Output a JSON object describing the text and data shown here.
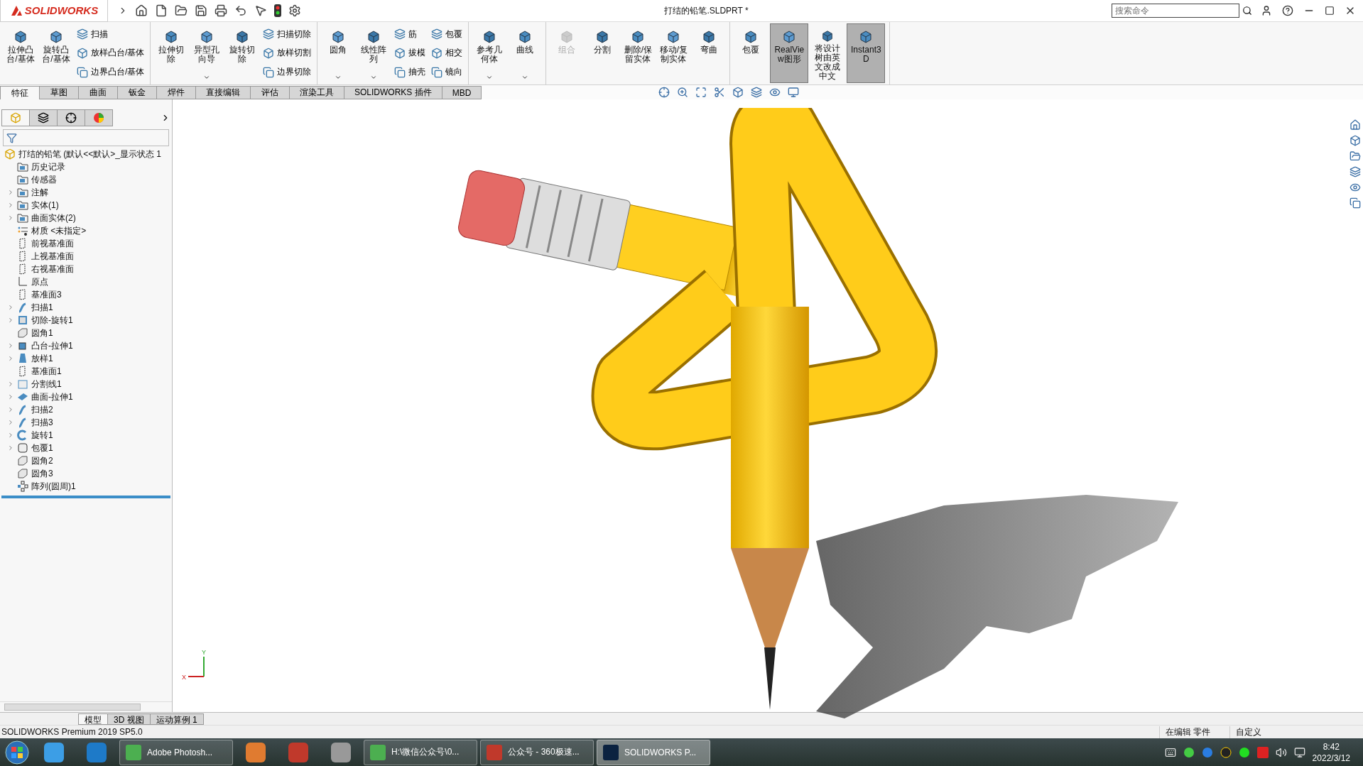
{
  "title_bar": {
    "logo": "SOLIDWORKS",
    "document_title": "打结的铅笔.SLDPRT *",
    "search_placeholder": "搜索命令"
  },
  "command_groups": [
    [
      {
        "kind": "large",
        "label": "拉伸凸台/基体",
        "dropdown": false,
        "selected": false,
        "disabled": false
      },
      {
        "kind": "large",
        "label": "旋转凸台/基体",
        "dropdown": false,
        "selected": false,
        "disabled": false
      },
      {
        "kind": "stack",
        "items": [
          {
            "label": "扫描"
          },
          {
            "label": "放样凸台/基体"
          },
          {
            "label": "边界凸台/基体"
          }
        ]
      }
    ],
    [
      {
        "kind": "large",
        "label": "拉伸切除",
        "dropdown": false,
        "selected": false,
        "disabled": false
      },
      {
        "kind": "large",
        "label": "异型孔向导",
        "dropdown": true,
        "selected": false,
        "disabled": false
      },
      {
        "kind": "large",
        "label": "旋转切除",
        "dropdown": false,
        "selected": false,
        "disabled": false
      },
      {
        "kind": "stack",
        "items": [
          {
            "label": "扫描切除"
          },
          {
            "label": "放样切割"
          },
          {
            "label": "边界切除"
          }
        ]
      }
    ],
    [
      {
        "kind": "large",
        "label": "圆角",
        "dropdown": true,
        "selected": false,
        "disabled": false
      },
      {
        "kind": "large",
        "label": "线性阵列",
        "dropdown": true,
        "selected": false,
        "disabled": false
      },
      {
        "kind": "stack",
        "items": [
          {
            "label": "筋"
          },
          {
            "label": "拔模"
          },
          {
            "label": "抽壳"
          }
        ]
      },
      {
        "kind": "stack",
        "items": [
          {
            "label": "包覆"
          },
          {
            "label": "相交"
          },
          {
            "label": "镜向"
          }
        ]
      }
    ],
    [
      {
        "kind": "large",
        "label": "参考几何体",
        "dropdown": true,
        "selected": false,
        "disabled": false
      },
      {
        "kind": "large",
        "label": "曲线",
        "dropdown": true,
        "selected": false,
        "disabled": false
      }
    ],
    [
      {
        "kind": "large",
        "label": "组合",
        "dropdown": false,
        "selected": false,
        "disabled": true
      },
      {
        "kind": "large",
        "label": "分割",
        "dropdown": false,
        "selected": false,
        "disabled": false
      },
      {
        "kind": "large",
        "label": "删除/保留实体",
        "dropdown": false,
        "selected": false,
        "disabled": false
      },
      {
        "kind": "large",
        "label": "移动/复制实体",
        "dropdown": false,
        "selected": false,
        "disabled": false
      },
      {
        "kind": "large",
        "label": "弯曲",
        "dropdown": false,
        "selected": false,
        "disabled": false
      }
    ],
    [
      {
        "kind": "large",
        "label": "包覆",
        "dropdown": false,
        "selected": false,
        "disabled": false
      },
      {
        "kind": "large",
        "label": "RealView图形",
        "dropdown": false,
        "selected": true,
        "disabled": false
      },
      {
        "kind": "large",
        "label": "将设计树由英文改成中文",
        "dropdown": false,
        "selected": false,
        "disabled": false
      },
      {
        "kind": "large",
        "label": "Instant3D",
        "dropdown": false,
        "selected": true,
        "disabled": false
      }
    ]
  ],
  "tabs": [
    {
      "label": "特征",
      "selected": true
    },
    {
      "label": "草图",
      "selected": false
    },
    {
      "label": "曲面",
      "selected": false
    },
    {
      "label": "钣金",
      "selected": false
    },
    {
      "label": "焊件",
      "selected": false
    },
    {
      "label": "直接编辑",
      "selected": false
    },
    {
      "label": "评估",
      "selected": false
    },
    {
      "label": "渲染工具",
      "selected": false
    },
    {
      "label": "SOLIDWORKS 插件",
      "selected": false
    },
    {
      "label": "MBD",
      "selected": false
    }
  ],
  "panel_tabs": [
    {
      "selected": true
    },
    {
      "selected": false
    },
    {
      "selected": false
    },
    {
      "selected": false
    }
  ],
  "feature_tree": {
    "root": "打结的铅笔  (默认<<默认>_显示状态 1",
    "items": [
      {
        "label": "历史记录",
        "kind": "folder",
        "expandable": false
      },
      {
        "label": "传感器",
        "kind": "folder",
        "expandable": false
      },
      {
        "label": "注解",
        "kind": "folder",
        "expandable": true
      },
      {
        "label": "实体(1)",
        "kind": "folder",
        "expandable": true
      },
      {
        "label": "曲面实体(2)",
        "kind": "folder",
        "expandable": true
      },
      {
        "label": "材质 <未指定>",
        "kind": "material",
        "expandable": false
      },
      {
        "label": "前视基准面",
        "kind": "plane",
        "expandable": false
      },
      {
        "label": "上视基准面",
        "kind": "plane",
        "expandable": false
      },
      {
        "label": "右视基准面",
        "kind": "plane",
        "expandable": false
      },
      {
        "label": "原点",
        "kind": "origin",
        "expandable": false
      },
      {
        "label": "基准面3",
        "kind": "plane",
        "expandable": false
      },
      {
        "label": "扫描1",
        "kind": "sweep",
        "expandable": true
      },
      {
        "label": "切除-旋转1",
        "kind": "cut",
        "expandable": true
      },
      {
        "label": "圆角1",
        "kind": "fillet",
        "expandable": false
      },
      {
        "label": "凸台-拉伸1",
        "kind": "extrude",
        "expandable": true
      },
      {
        "label": "放样1",
        "kind": "loft",
        "expandable": true
      },
      {
        "label": "基准面1",
        "kind": "plane",
        "expandable": false
      },
      {
        "label": "分割线1",
        "kind": "split",
        "expandable": true
      },
      {
        "label": "曲面-拉伸1",
        "kind": "surface",
        "expandable": true
      },
      {
        "label": "扫描2",
        "kind": "sweep",
        "expandable": true
      },
      {
        "label": "扫描3",
        "kind": "sweep",
        "expandable": true
      },
      {
        "label": "旋转1",
        "kind": "revolve",
        "expandable": true
      },
      {
        "label": "包覆1",
        "kind": "wrap",
        "expandable": true
      },
      {
        "label": "圆角2",
        "kind": "fillet",
        "expandable": false
      },
      {
        "label": "圆角3",
        "kind": "fillet",
        "expandable": false
      },
      {
        "label": "阵列(圆周)1",
        "kind": "pattern",
        "expandable": false
      }
    ]
  },
  "triad": {
    "x_label": "X",
    "y_label": "Y"
  },
  "bottom_tabs": [
    {
      "label": "模型",
      "selected": true
    },
    {
      "label": "3D 视图",
      "selected": false
    },
    {
      "label": "运动算例 1",
      "selected": false
    }
  ],
  "status_bar": {
    "product": "SOLIDWORKS Premium 2019 SP5.0",
    "mode": "在编辑 零件",
    "units": "自定义"
  },
  "taskbar": {
    "items": [
      {
        "kind": "icon",
        "selected": false
      },
      {
        "kind": "icon",
        "selected": false
      },
      {
        "kind": "window",
        "label": "Adobe Photosh...",
        "selected": false
      },
      {
        "kind": "icon",
        "selected": false
      },
      {
        "kind": "icon",
        "selected": false
      },
      {
        "kind": "icon",
        "selected": false
      },
      {
        "kind": "window",
        "label": "H:\\微信公众号\\0...",
        "selected": false
      },
      {
        "kind": "window",
        "label": "公众号 - 360极速...",
        "selected": false
      },
      {
        "kind": "window",
        "label": "SOLIDWORKS P...",
        "selected": true
      }
    ],
    "time": "8:42",
    "date": "2022/3/12"
  }
}
